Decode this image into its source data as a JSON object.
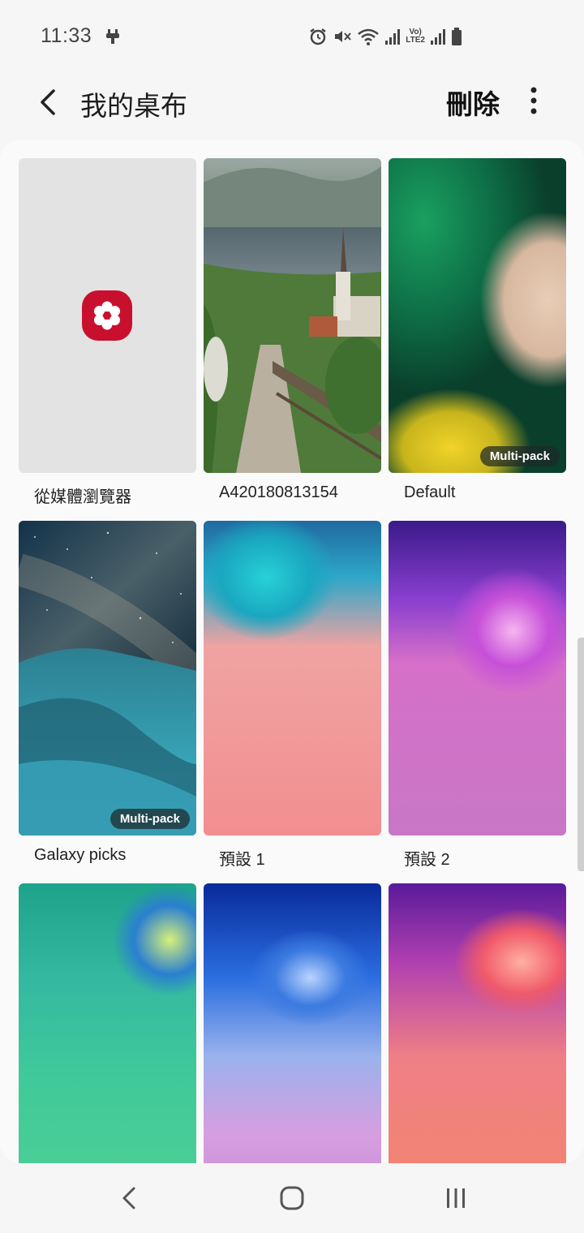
{
  "status": {
    "time": "11:33",
    "lte": "Vo) LTE2"
  },
  "header": {
    "title": "我的桌布",
    "delete_label": "刪除"
  },
  "wallpapers": [
    {
      "label": "從媒體瀏覽器",
      "badge": ""
    },
    {
      "label": "A420180813154",
      "badge": ""
    },
    {
      "label": "Default",
      "badge": "Multi-pack"
    },
    {
      "label": "Galaxy picks",
      "badge": "Multi-pack"
    },
    {
      "label": "預設 1",
      "badge": ""
    },
    {
      "label": "預設 2",
      "badge": ""
    },
    {
      "label": "",
      "badge": ""
    },
    {
      "label": "",
      "badge": ""
    },
    {
      "label": "",
      "badge": ""
    }
  ],
  "icons": {
    "back": "back-arrow-icon",
    "more": "more-options-icon",
    "gallery": "gallery-flower-icon",
    "nav_back": "nav-back-icon",
    "nav_home": "nav-home-icon",
    "nav_recents": "nav-recents-icon"
  },
  "colors": {
    "gallery_icon": "#c8102e",
    "background": "#f6f6f6"
  }
}
